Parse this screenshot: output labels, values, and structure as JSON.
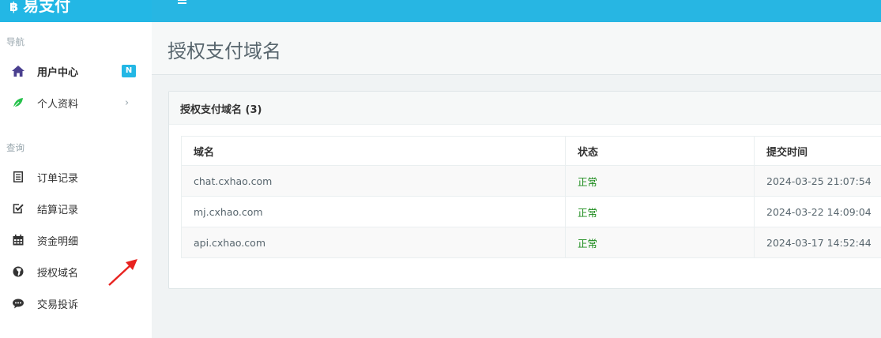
{
  "app": {
    "brand": "易支付",
    "brand_icon": "bitcoin-icon",
    "accent_color": "#23b7e5"
  },
  "sidebar": {
    "sections": [
      {
        "heading": "导航",
        "items": [
          {
            "label": "用户中心",
            "icon": "home-icon",
            "badge": "N",
            "active": true
          },
          {
            "label": "个人资料",
            "icon": "leaf-icon",
            "chevron": "›"
          }
        ]
      },
      {
        "heading": "查询",
        "items": [
          {
            "label": "订单记录",
            "icon": "list-icon"
          },
          {
            "label": "结算记录",
            "icon": "check-square-icon"
          },
          {
            "label": "资金明细",
            "icon": "calendar-icon"
          },
          {
            "label": "授权域名",
            "icon": "globe-icon"
          },
          {
            "label": "交易投诉",
            "icon": "comment-icon"
          }
        ]
      }
    ]
  },
  "page": {
    "title": "授权支付域名"
  },
  "panel": {
    "title": "授权支付域名 (3)",
    "table": {
      "headers": [
        "域名",
        "状态",
        "提交时间"
      ],
      "rows": [
        [
          "chat.cxhao.com",
          "正常",
          "2024-03-25 21:07:54"
        ],
        [
          "mj.cxhao.com",
          "正常",
          "2024-03-22 14:09:04"
        ],
        [
          "api.cxhao.com",
          "正常",
          "2024-03-17 14:52:44"
        ]
      ]
    }
  }
}
